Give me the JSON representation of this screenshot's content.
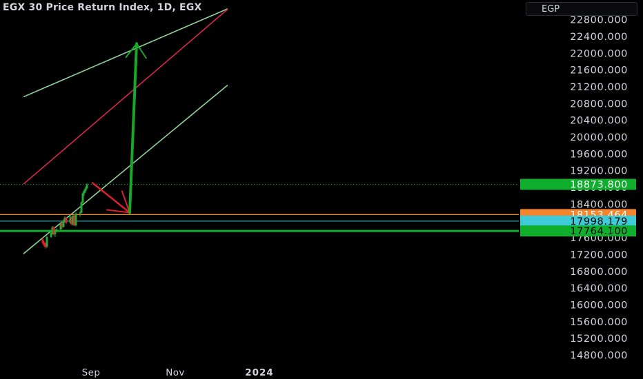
{
  "header": {
    "title": "EGX 30 Price Return Index, 1D, EGX",
    "currency": "EGP"
  },
  "colors": {
    "background": "#000000",
    "axis_text": "#d1d4dc",
    "candle_up": "#22ab35",
    "candle_down": "#e01e2c",
    "channel_outer": "#90d39a",
    "channel_mid": "#d7264d",
    "arrow_up": "#17a82a",
    "arrow_down": "#e0202a",
    "level_orange": "#f5842a",
    "level_cyan": "#3ecbd8",
    "level_green": "#0fae2c",
    "label_current": "#0fae2c"
  },
  "chart_data": {
    "type": "candlestick",
    "title": "EGX 30 Price Return Index, 1D, EGX",
    "y_axis": {
      "side": "right",
      "range": [
        14550,
        23100
      ],
      "ticks": [
        14800,
        15200,
        15600,
        16000,
        16400,
        16800,
        17200,
        17600,
        18000,
        18400,
        18800,
        19200,
        19600,
        20000,
        20400,
        20800,
        21200,
        21600,
        22000,
        22400,
        22800
      ],
      "tick_labels": [
        "14800.000",
        "15200.000",
        "15600.000",
        "16000.000",
        "16400.000",
        "16800.000",
        "17200.000",
        "17600.000",
        "18000.000",
        "18400.000",
        "18800.000",
        "19200.000",
        "19600.000",
        "20000.000",
        "20400.000",
        "20800.000",
        "21200.000",
        "21600.000",
        "22000.000",
        "22400.000",
        "22800.000"
      ]
    },
    "x_axis": {
      "labels": [
        {
          "text": "Sep",
          "day": 0
        },
        {
          "text": "Nov",
          "day": 61
        },
        {
          "text": "2024",
          "day": 122
        }
      ]
    },
    "candles": [
      {
        "day": -31,
        "open": 17560,
        "high": 17610,
        "low": 17450,
        "close": 17480
      },
      {
        "day": -30,
        "open": 17490,
        "high": 17520,
        "low": 17380,
        "close": 17420
      },
      {
        "day": -29,
        "open": 17430,
        "high": 17480,
        "low": 17340,
        "close": 17380
      },
      {
        "day": -28,
        "open": 17390,
        "high": 17660,
        "low": 17360,
        "close": 17620
      },
      {
        "day": -25,
        "open": 17620,
        "high": 17780,
        "low": 17600,
        "close": 17720
      },
      {
        "day": -24,
        "open": 17720,
        "high": 17880,
        "low": 17680,
        "close": 17850
      },
      {
        "day": -23,
        "open": 17850,
        "high": 17890,
        "low": 17640,
        "close": 17680
      },
      {
        "day": -22,
        "open": 17690,
        "high": 17800,
        "low": 17620,
        "close": 17770
      },
      {
        "day": -21,
        "open": 17780,
        "high": 17830,
        "low": 17740,
        "close": 17800
      },
      {
        "day": -18,
        "open": 17800,
        "high": 17980,
        "low": 17780,
        "close": 17960
      },
      {
        "day": -17,
        "open": 17960,
        "high": 18000,
        "low": 17820,
        "close": 17860
      },
      {
        "day": -16,
        "open": 17860,
        "high": 18040,
        "low": 17840,
        "close": 18010
      },
      {
        "day": -15,
        "open": 18010,
        "high": 18120,
        "low": 17960,
        "close": 18080
      },
      {
        "day": -14,
        "open": 18080,
        "high": 18100,
        "low": 17920,
        "close": 17960
      },
      {
        "day": -11,
        "open": 17960,
        "high": 18140,
        "low": 17930,
        "close": 18100
      },
      {
        "day": -10,
        "open": 18090,
        "high": 18110,
        "low": 17900,
        "close": 17920
      },
      {
        "day": -9,
        "open": 17920,
        "high": 18150,
        "low": 17890,
        "close": 18130
      },
      {
        "day": -8,
        "open": 18120,
        "high": 18160,
        "low": 17880,
        "close": 17900
      },
      {
        "day": -7,
        "open": 17900,
        "high": 18200,
        "low": 17870,
        "close": 18180
      },
      {
        "day": -4,
        "open": 18180,
        "high": 18230,
        "low": 18100,
        "close": 18200
      },
      {
        "day": -3,
        "open": 18200,
        "high": 18470,
        "low": 18180,
        "close": 18440
      },
      {
        "day": -2,
        "open": 18440,
        "high": 18690,
        "low": 18420,
        "close": 18660
      },
      {
        "day": -1,
        "open": 18660,
        "high": 18750,
        "low": 18600,
        "close": 18720
      },
      {
        "day": 0,
        "open": 18720,
        "high": 18820,
        "low": 18680,
        "close": 18780
      },
      {
        "day": 1,
        "open": 18780,
        "high": 18900,
        "low": 18760,
        "close": 18874
      }
    ],
    "channel": {
      "upper": [
        {
          "day": -45,
          "price": 20960
        },
        {
          "day": 103,
          "price": 23060
        }
      ],
      "middle": [
        {
          "day": -45,
          "price": 18880
        },
        {
          "day": 103,
          "price": 23050
        }
      ],
      "lower": [
        {
          "day": -45,
          "price": 17220
        },
        {
          "day": 103,
          "price": 21240
        }
      ]
    },
    "arrows": [
      {
        "name": "projected-pullback",
        "from": {
          "day": 5,
          "price": 18910
        },
        "to": {
          "day": 32,
          "price": 18200
        }
      },
      {
        "name": "projected-rally",
        "from": {
          "day": 32,
          "price": 18200
        },
        "to": {
          "day": 37,
          "price": 22230
        }
      }
    ],
    "levels": [
      {
        "price": 18873.8,
        "label": "18873.800",
        "style": "dotted",
        "color": "#0fae2c"
      },
      {
        "price": 18153.464,
        "label": "18153.464",
        "style": "solid",
        "color": "#f5842a"
      },
      {
        "price": 17998.179,
        "label": "17998.179",
        "style": "solid",
        "color": "#3ecbd8"
      },
      {
        "price": 17764.1,
        "label": "17764.100",
        "style": "solid-thick",
        "color": "#0fae2c"
      }
    ],
    "grid": false,
    "legend": "none"
  }
}
